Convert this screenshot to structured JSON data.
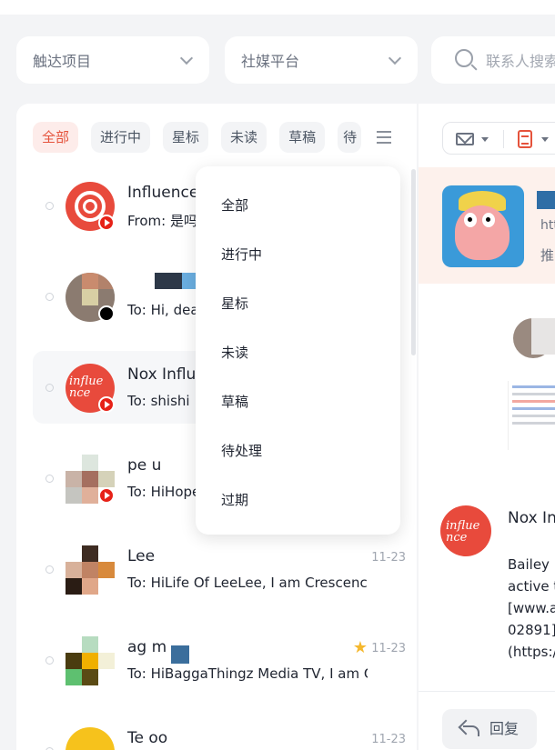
{
  "filters": {
    "reach_project": "触达项目",
    "social_platform": "社媒平台",
    "search_placeholder": "联系人搜索"
  },
  "tabs": [
    {
      "label": "全部",
      "active": true
    },
    {
      "label": "进行中"
    },
    {
      "label": "星标"
    },
    {
      "label": "未读"
    },
    {
      "label": "草稿"
    },
    {
      "label": "待"
    }
  ],
  "threads": [
    {
      "name": "Influence",
      "snippet": "From: 是吗",
      "platform": "youtube",
      "avatar": "influencer-logo"
    },
    {
      "name": "",
      "snippet": "To: Hi, dea",
      "platform": "tiktok",
      "avatar": "photo"
    },
    {
      "name": "Nox Influ",
      "snippet": "To: shishi",
      "platform": "youtube",
      "avatar": "nox-logo",
      "selected": true
    },
    {
      "name": "pe   u",
      "snippet": "To: HiHope",
      "platform": "youtube",
      "avatar": "photo"
    },
    {
      "name": "Lee",
      "snippet": "To: HiLife Of LeeLee, I am Crescencio",
      "platform": "youtube",
      "avatar": "photo",
      "date": "11-23"
    },
    {
      "name": "ag    m",
      "snippet": "To: HiBaggaThingz Media TV, I am Cr",
      "platform": "youtube",
      "avatar": "photo",
      "date": "11-23",
      "starred": true
    },
    {
      "name": "Te          oo",
      "snippet": "",
      "platform": "youtube",
      "avatar": "photo",
      "date": "11-23"
    }
  ],
  "status_menu": {
    "items": [
      "全部",
      "进行中",
      "星标",
      "未读",
      "草稿",
      "待处理",
      "过期"
    ]
  },
  "detail": {
    "link_fragment": "htt",
    "push_fragment": "推",
    "sender_name": "Nox In",
    "body_lines": [
      "Bailey i",
      "active t",
      "[www.a",
      "02891](",
      "(https:/"
    ],
    "reply_label": "回复"
  },
  "colors": {
    "accent": "#e5533c",
    "accent_bg": "#fdecea",
    "youtube": "#e62117",
    "star": "#f5b82e"
  }
}
